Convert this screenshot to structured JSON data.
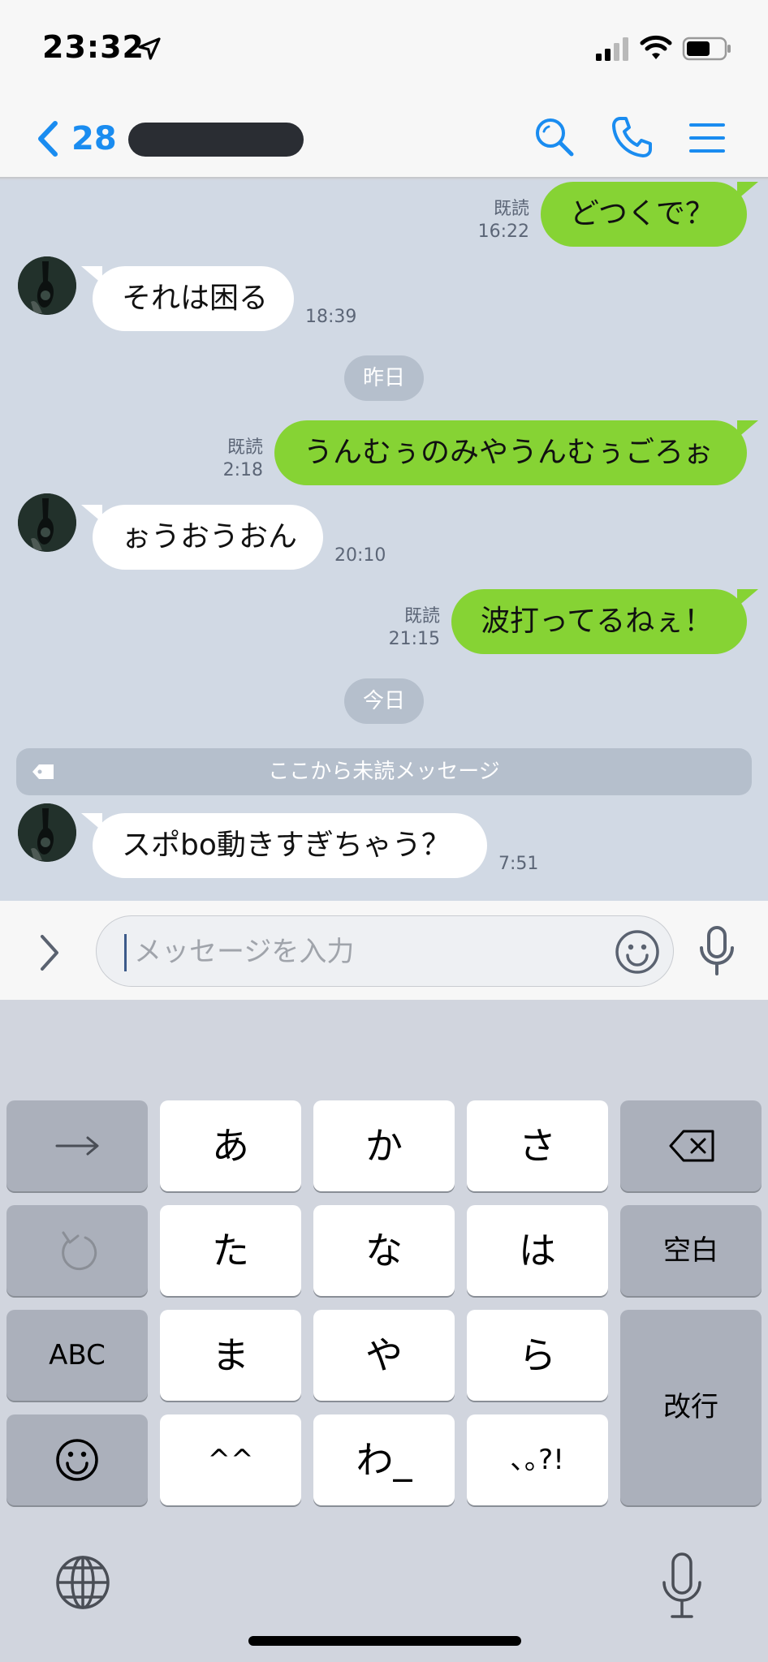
{
  "status_bar": {
    "time": "23:32",
    "icons": [
      "location-arrow-icon",
      "cellular-signal-icon",
      "wifi-icon",
      "battery-icon"
    ]
  },
  "header": {
    "back_count": "28",
    "icons": [
      "chevron-left-icon",
      "search-icon",
      "phone-icon",
      "menu-icon"
    ],
    "accent_color": "#1a8cf0"
  },
  "messages": [
    {
      "direction": "out",
      "text": "どつくで？",
      "read": "既読",
      "time": "16:22"
    },
    {
      "direction": "in",
      "text": "それは困る",
      "time": "18:39"
    },
    {
      "direction": "date",
      "text": "昨日"
    },
    {
      "direction": "out",
      "text": "うんむぅのみやうんむぅごろぉ",
      "read": "既読",
      "time": "2:18"
    },
    {
      "direction": "in",
      "text": "ぉうおうおん",
      "time": "20:10"
    },
    {
      "direction": "out",
      "text": "波打ってるねぇ！",
      "read": "既読",
      "time": "21:15"
    },
    {
      "direction": "date",
      "text": "今日"
    },
    {
      "direction": "in",
      "text": "スポbo動きすぎちゃう？",
      "time": "7:51"
    }
  ],
  "unread_divider": "ここから未読メッセージ",
  "input": {
    "placeholder": "メッセージを入力"
  },
  "keyboard": {
    "rows": [
      [
        "→",
        "あ",
        "か",
        "さ",
        "⌫"
      ],
      [
        "↺",
        "た",
        "な",
        "は",
        "空白"
      ],
      [
        "ABC",
        "ま",
        "や",
        "ら",
        "改行"
      ],
      [
        "☺",
        "^^",
        "わ_",
        "､｡?!"
      ]
    ]
  },
  "colors": {
    "outgoing_bubble": "#86d334",
    "incoming_bubble": "#ffffff",
    "chat_background": "#d1d9e4"
  }
}
